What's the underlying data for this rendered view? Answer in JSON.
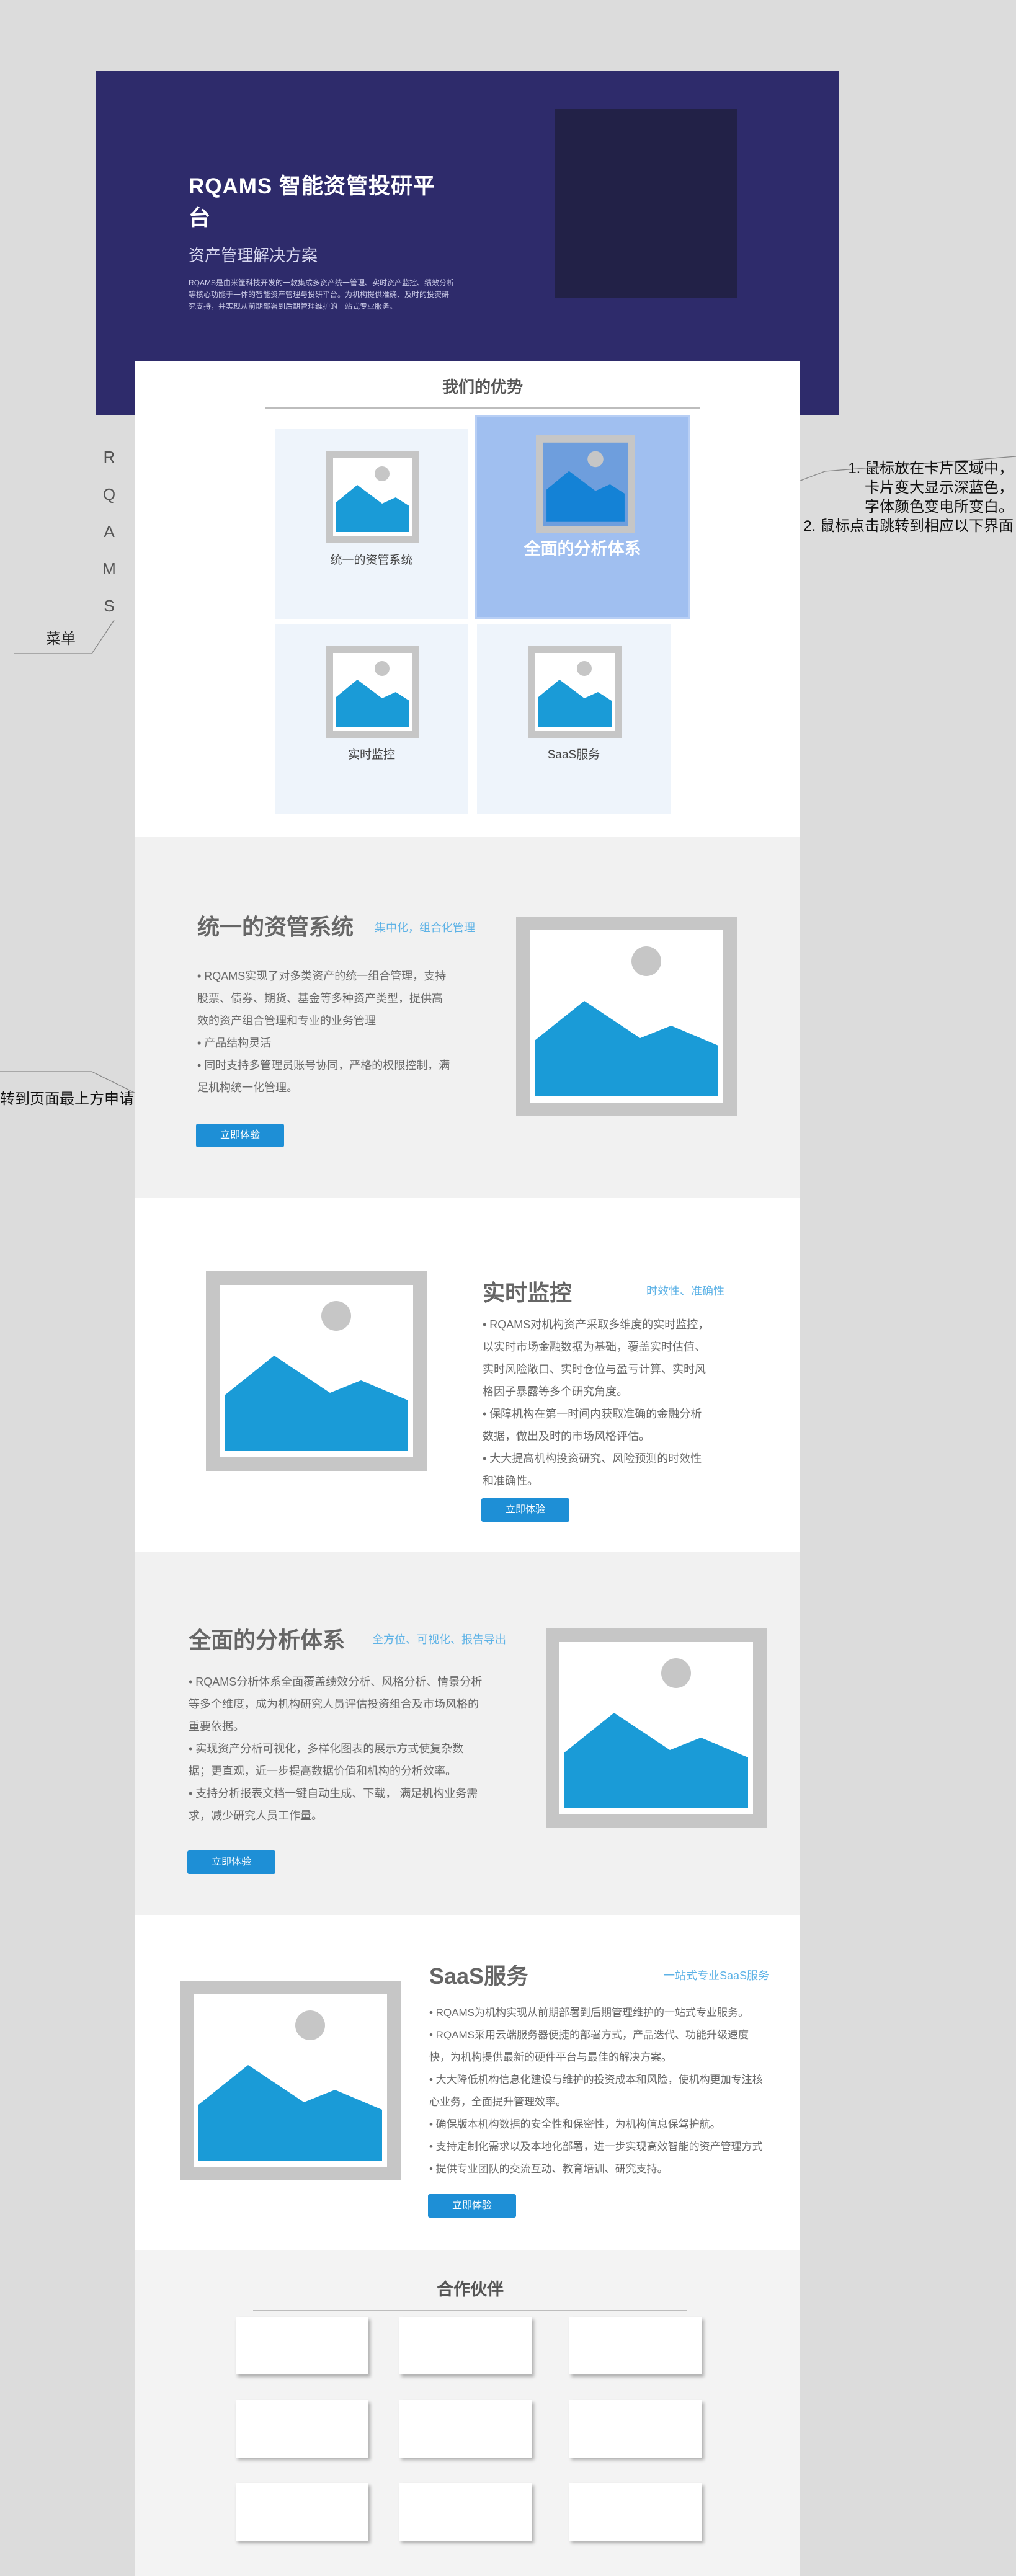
{
  "hero": {
    "title": "RQAMS 智能资管投研平台",
    "subtitle": "资产管理解决方案",
    "description": "RQAMS是由米筐科技开发的一款集成多资产统一管理、实时资产监控、绩效分析等核心功能于一体的智能资产管理与投研平台。为机构提供准确、及时的投资研究支持，并实现从前期部署到后期管理维护的一站式专业服务。"
  },
  "advantages": {
    "heading": "我们的优势",
    "cards": [
      {
        "label": "统一的资管系统"
      },
      {
        "label": "全面的分析体系"
      },
      {
        "label": "实时监控"
      },
      {
        "label": "SaaS服务"
      }
    ]
  },
  "sidemenu": {
    "letters": [
      "R",
      "Q",
      "A",
      "M",
      "S"
    ],
    "label": "菜单"
  },
  "annotations": {
    "hover_note_1": "1. 鼠标放在卡片区域中，",
    "hover_note_2": "卡片变大显示深蓝色，",
    "hover_note_3": "字体颜色变电所变白。",
    "hover_note_4": "2. 鼠标点击跳转到相应以下界面",
    "apply_note": "转到页面最上方申请"
  },
  "sections": {
    "unified": {
      "title": "统一的资管系统",
      "tag": "集中化，组合化管理",
      "lines": [
        "• RQAMS实现了对多类资产的统一组合管理，支持",
        "股票、债券、期货、基金等多种资产类型，提供高",
        "效的资产组合管理和专业的业务管理",
        "• 产品结构灵活",
        "• 同时支持多管理员账号协同，严格的权限控制，满",
        "足机构统一化管理。"
      ],
      "button": "立即体验"
    },
    "realtime": {
      "title": "实时监控",
      "tag": "时效性、准确性",
      "lines": [
        "• RQAMS对机构资产采取多维度的实时监控，",
        "以实时市场金融数据为基础，覆盖实时估值、",
        "实时风险敞口、实时仓位与盈亏计算、实时风",
        "格因子暴露等多个研究角度。",
        "• 保障机构在第一时间内获取准确的金融分析",
        "数据，做出及时的市场风格评估。",
        "• 大大提高机构投资研究、风险预测的时效性",
        "和准确性。"
      ],
      "button": "立即体验"
    },
    "analysis": {
      "title": "全面的分析体系",
      "tag": "全方位、可视化、报告导出",
      "lines": [
        "• RQAMS分析体系全面覆盖绩效分析、风格分析、情景分析",
        "等多个维度，成为机构研究人员评估投资组合及市场风格的",
        "重要依据。",
        "• 实现资产分析可视化，多样化图表的展示方式使复杂数",
        "据；更直观，近一步提高数据价值和机构的分析效率。",
        "• 支持分析报表文档一键自动生成、下载， 满足机构业务需",
        "求，减少研究人员工作量。"
      ],
      "button": "立即体验"
    },
    "saas": {
      "title": "SaaS服务",
      "tag": "一站式专业SaaS服务",
      "lines": [
        "• RQAMS为机构实现从前期部署到后期管理维护的一站式专业服务。",
        "• RQAMS采用云端服务器便捷的部署方式，产品迭代、功能升级速度",
        "快，为机构提供最新的硬件平台与最佳的解决方案。",
        "• 大大降低机构信息化建设与维护的投资成本和风险，使机构更加专注核",
        "心业务，全面提升管理效率。",
        "• 确保版本机构数据的安全性和保密性，为机构信息保驾护航。",
        "• 支持定制化需求以及本地化部署，进一步实现高效智能的资产管理方式",
        "• 提供专业团队的交流互动、教育培训、研究支持。"
      ],
      "button": "立即体验"
    }
  },
  "partners": {
    "heading": "合作伙伴",
    "count_visible": 9
  },
  "colors": {
    "hero_bg": "#2e2b6b",
    "accent": "#1e8fd6",
    "card_active": "#a0bff0",
    "tag": "#5db2e6"
  }
}
